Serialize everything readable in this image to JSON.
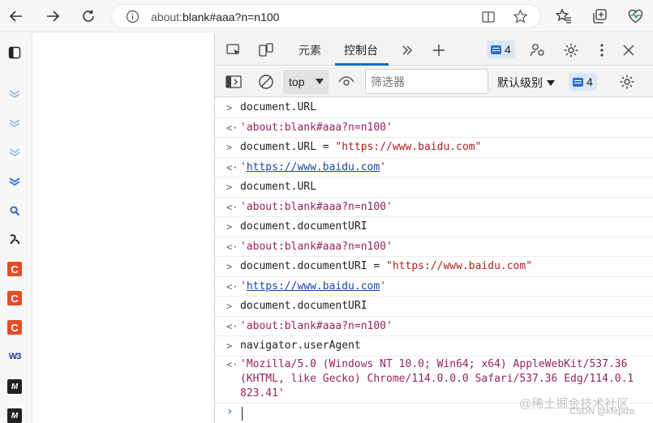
{
  "browser": {
    "address": "about:blank#aaa?n=n100",
    "address_prefix": "about:",
    "address_main": "blank#aaa?n=n100"
  },
  "devtools": {
    "tabs": [
      {
        "label": "元素"
      },
      {
        "label": "控制台"
      }
    ],
    "issues_count": "4",
    "context": "top",
    "filter_placeholder": "筛选器",
    "level": "默认级别",
    "messages_count": "4"
  },
  "console": {
    "lines": [
      {
        "kind": "input",
        "text": "document.URL"
      },
      {
        "kind": "output",
        "text": "'about:blank#aaa?n=n100'"
      },
      {
        "kind": "input",
        "code": "document.URL = ",
        "str": "\"https://www.baidu.com\""
      },
      {
        "kind": "output-link",
        "link": "https://www.baidu.com"
      },
      {
        "kind": "input",
        "text": "document.URL"
      },
      {
        "kind": "output",
        "text": "'about:blank#aaa?n=n100'"
      },
      {
        "kind": "input",
        "text": "document.documentURI"
      },
      {
        "kind": "output",
        "text": "'about:blank#aaa?n=n100'"
      },
      {
        "kind": "input",
        "code": "document.documentURI = ",
        "str": "\"https://www.baidu.com\""
      },
      {
        "kind": "output-link",
        "link": "https://www.baidu.com"
      },
      {
        "kind": "input",
        "text": "document.documentURI"
      },
      {
        "kind": "output",
        "text": "'about:blank#aaa?n=n100'"
      },
      {
        "kind": "input",
        "text": "navigator.userAgent"
      },
      {
        "kind": "output-multi",
        "text": "'Mozilla/5.0 (Windows NT 10.0; Win64; x64) AppleWebKit/537.36 (KHTML, like Gecko) Chrome/114.0.0.0 Safari/537.36 Edg/114.0.1823.41'"
      }
    ]
  },
  "watermark": {
    "line1": "@稀土掘金技术社区",
    "line2": "CSDN @kfepiza"
  },
  "colors": {
    "accent": "#0f6cbd",
    "string_output": "#96225c",
    "string_input": "#b11e1e",
    "link": "#1a45a8"
  }
}
